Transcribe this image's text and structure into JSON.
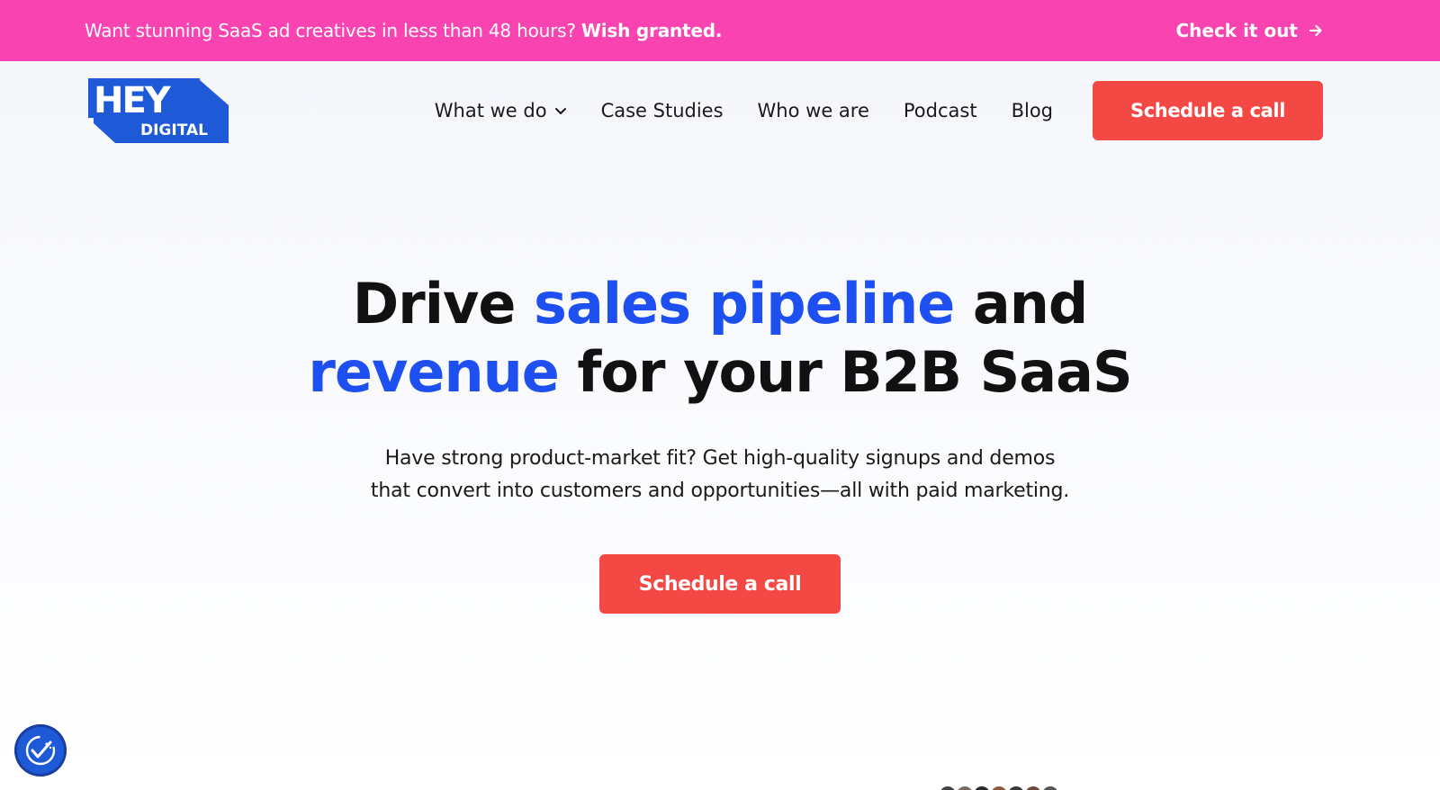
{
  "promo": {
    "text": "Want stunning SaaS ad creatives in less than 48 hours?",
    "highlight": "Wish granted.",
    "cta_label": "Check it out"
  },
  "header": {
    "logo": {
      "word": "HEY",
      "sub": "DIGITAL"
    },
    "nav": [
      {
        "label": "What we do",
        "has_dropdown": true
      },
      {
        "label": "Case Studies"
      },
      {
        "label": "Who we are"
      },
      {
        "label": "Podcast"
      },
      {
        "label": "Blog"
      }
    ],
    "cta_label": "Schedule a call"
  },
  "hero": {
    "title_part1": "Drive ",
    "title_accent1": "sales pipeline",
    "title_part2": " and",
    "title_accent2": "revenue",
    "title_part3": " for your B2B SaaS",
    "subtitle_line1": "Have strong product-market fit? Get high-quality signups and demos",
    "subtitle_line2": "that convert into customers and opportunities—all with paid marketing.",
    "cta_label": "Schedule a call"
  },
  "colors": {
    "promo_bg": "#f843b0",
    "accent": "#1e4ff0",
    "cta": "#f44844",
    "logo_blue": "#1e5ad8"
  },
  "icons": {
    "promo_arrow": "arrow-right-icon",
    "nav_dropdown": "chevron-down-icon",
    "accessibility": "accessibility-icon"
  }
}
